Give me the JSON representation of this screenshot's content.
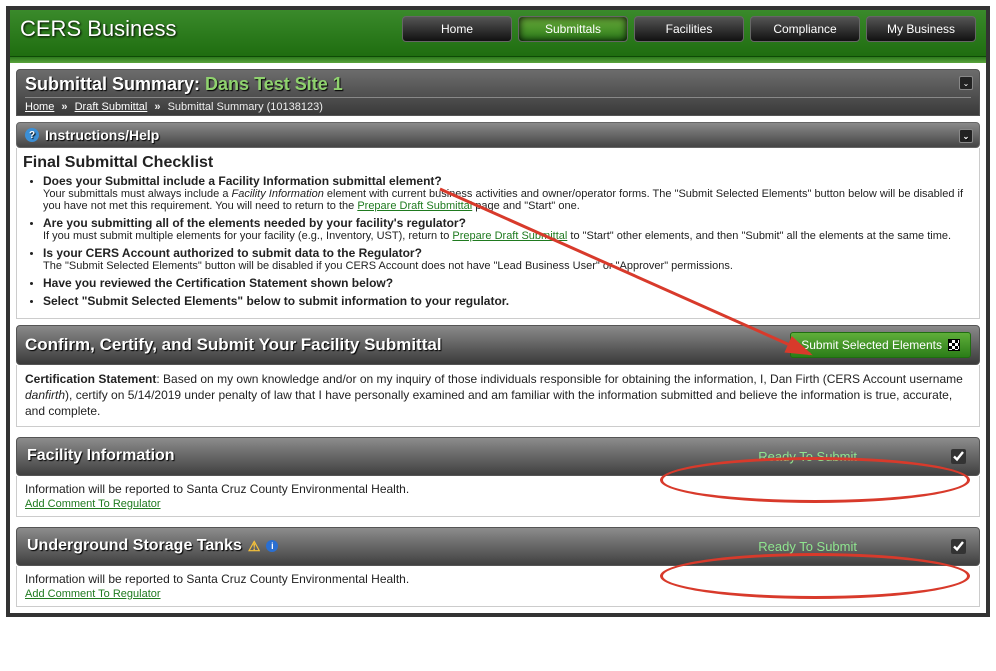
{
  "brand": "CERS Business",
  "nav": {
    "home": "Home",
    "submittals": "Submittals",
    "facilities": "Facilities",
    "compliance": "Compliance",
    "mybusiness": "My Business"
  },
  "page_title_prefix": "Submittal Summary: ",
  "page_title_site": "Dans Test Site 1",
  "breadcrumb": {
    "home": "Home",
    "draft": "Draft Submittal",
    "current": "Submittal Summary (10138123)"
  },
  "instructions_label": "Instructions/Help",
  "checklist_heading": "Final Submittal Checklist",
  "checklist": [
    {
      "lead": "Does your Submittal include a Facility Information submittal element?",
      "body_pre": "Your submittals must always include a ",
      "body_em": "Facility Information",
      "body_mid": " element with current business activities and owner/operator forms. The \"Submit Selected Elements\" button below will be disabled if you have not met this requirement. You will need to return to the ",
      "link": "Prepare Draft Submittal",
      "body_post": " page and \"Start\" one."
    },
    {
      "lead": "Are you submitting all of the elements needed by your facility's regulator?",
      "body_pre": "If you must submit multiple elements for your facility (e.g., Inventory, UST), return to ",
      "link": "Prepare Draft Submittal",
      "body_post": " to \"Start\" other elements, and then \"Submit\" all the elements at the same time."
    },
    {
      "lead": "Is your CERS Account authorized to submit data to the Regulator?",
      "body_pre": "The \"Submit Selected Elements\" button will be disabled if you CERS Account does not have \"Lead Business User\" or \"Approver\" permissions."
    },
    {
      "lead": "Have you reviewed the Certification Statement shown below?"
    },
    {
      "lead": "Select \"Submit Selected Elements\" below to submit information to your regulator."
    }
  ],
  "confirm_title": "Confirm, Certify, and Submit Your Facility Submittal",
  "submit_button": "Submit Selected Elements",
  "certification": {
    "label": "Certification Statement",
    "text_a": ": Based on my own knowledge and/or on my inquiry of those individuals responsible for obtaining the information, I, Dan Firth (CERS Account username ",
    "username": "danfirth",
    "text_b": "), certify on 5/14/2019 under penalty of law that I have personally examined and am familiar with the information submitted and believe the information is true, accurate, and complete."
  },
  "elements": [
    {
      "title": "Facility Information",
      "status": "Ready To Submit",
      "info": "Information will be reported to Santa Cruz County Environmental Health.",
      "add_comment": "Add Comment To Regulator",
      "warn": false
    },
    {
      "title": "Underground Storage Tanks",
      "status": "Ready To Submit",
      "info": "Information will be reported to Santa Cruz County Environmental Health.",
      "add_comment": "Add Comment To Regulator",
      "warn": true
    }
  ]
}
